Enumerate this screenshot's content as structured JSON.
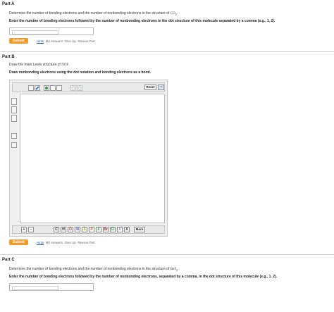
{
  "partA": {
    "title": "Part A",
    "question_pre": "Determine the number of bonding electrons and the number of nonbonding electrons in the structure of ",
    "formula_main": "CO",
    "formula_sub": "2",
    "question_post": ".",
    "instruction": "Enter the number of bonding electrons followed by the number of nonbonding electrons in the dot structure of this molecule separated by a comma (e.g., 1, 2).",
    "submit": "Submit",
    "links": [
      "Hints",
      "My Answers",
      "Give Up",
      "Review Part"
    ]
  },
  "partB": {
    "title": "Part B",
    "question_pre": "Draw the main Lewis structure of ",
    "formula": "NOF",
    "question_post": ".",
    "instruction": "Draw nonbonding electrons using the dot notation and bonding electrons as a bond.",
    "reset": "Reset",
    "help": "?",
    "plus": "+",
    "minus": "-",
    "atoms": [
      "C",
      "H",
      "O",
      "N",
      "S",
      "P",
      "F",
      "Br",
      "Cl",
      "I",
      "X"
    ],
    "more": "More",
    "submit": "Submit",
    "links": [
      "Hints",
      "My Answers",
      "Give Up",
      "Review Part"
    ]
  },
  "partC": {
    "title": "Part C",
    "question_pre": "Determine the number of bonding electrons and the number of nonbonding electrons in the structure of ",
    "formula_main": "BeF",
    "formula_sub": "2",
    "question_post": ".",
    "instruction": "Enter the number of bonding electrons followed by the number of nonbonding electrons, separated by a comma, in the dot structure of this molecule (e.g., 1, 2)."
  },
  "colors": {
    "submit": "#f39a2b",
    "link": "#2a5db0"
  }
}
